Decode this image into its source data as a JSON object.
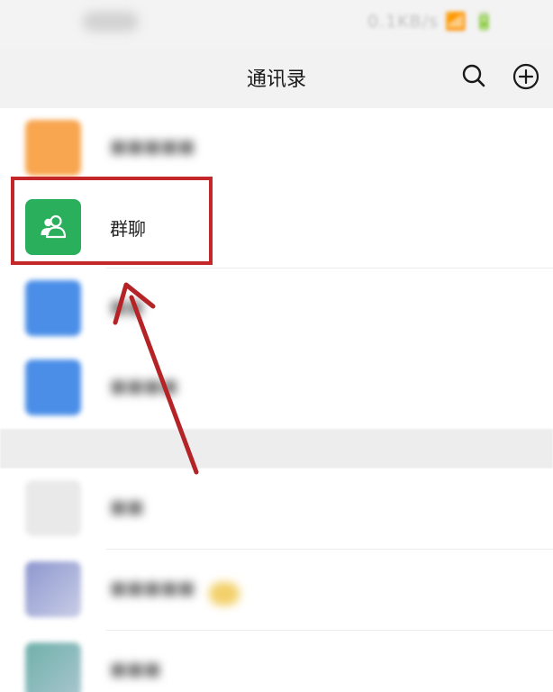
{
  "status_bar": {
    "right_text": "0.1KB/s 📶 🔋"
  },
  "header": {
    "title": "通讯录",
    "icons": [
      "search-icon",
      "plus-circle-icon"
    ]
  },
  "contacts_list": {
    "group_chat_label": "群聊",
    "group_chat_icon": "people-icon"
  },
  "colors": {
    "group_chat": "#2ab05c",
    "new_friends": "#f8a64f",
    "blue_item": "#4a8ee8",
    "annotation": "#c4272a"
  }
}
